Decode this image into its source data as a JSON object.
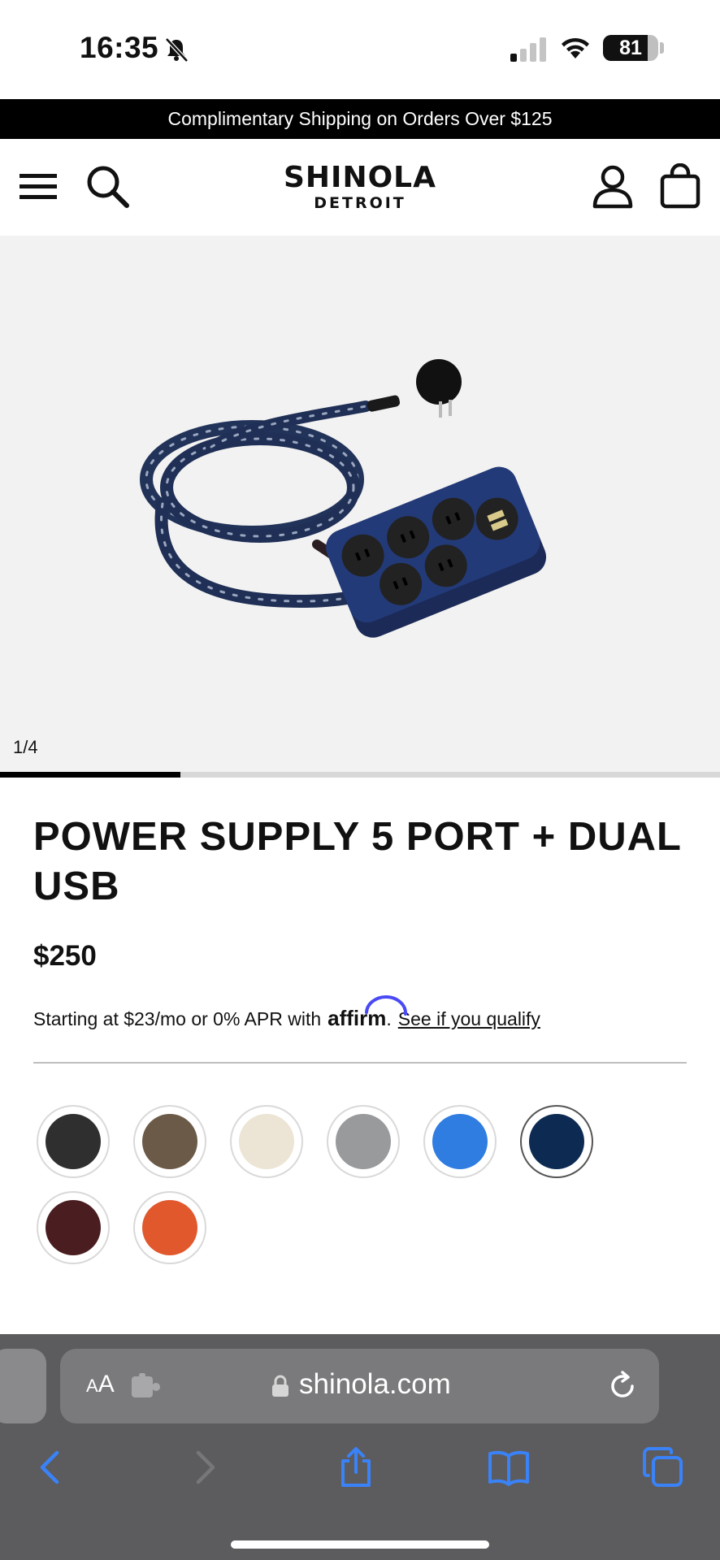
{
  "status_bar": {
    "time": "16:35",
    "battery": "81",
    "battery_level": 0.81
  },
  "promo_banner": {
    "text": "Complimentary Shipping on Orders Over $125"
  },
  "header": {
    "logo_main": "SHINOLA",
    "logo_sub": "DETROIT",
    "icons": [
      "menu-icon",
      "search-icon",
      "account-icon",
      "bag-icon"
    ]
  },
  "gallery": {
    "counter": "1/4",
    "progress": 0.25
  },
  "product": {
    "title": "POWER SUPPLY 5 PORT + DUAL USB",
    "price": "$250",
    "financing_text": "Starting at $23/mo or 0% APR with",
    "affirm_logo": "affirm",
    "financing_period": ".",
    "qualify_link": "See if you qualify"
  },
  "colors": {
    "accent_affirm": "#4a4af4",
    "safari_blue": "#3a82f7"
  },
  "swatches": [
    {
      "color": "#2f2f2f",
      "selected": false
    },
    {
      "color": "#6b5a47",
      "selected": false
    },
    {
      "color": "#ece4d4",
      "selected": false
    },
    {
      "color": "#999a9c",
      "selected": false
    },
    {
      "color": "#2f7de1",
      "selected": false
    },
    {
      "color": "#0d2a52",
      "selected": true
    },
    {
      "color": "#4a1d20",
      "selected": false
    },
    {
      "color": "#e2582d",
      "selected": false
    }
  ],
  "browser": {
    "aa_small": "A",
    "aa_large": "A",
    "url": "shinola.com",
    "toolbar_icons": [
      "back-icon",
      "forward-icon",
      "share-icon",
      "bookmarks-icon",
      "tabs-icon"
    ]
  }
}
